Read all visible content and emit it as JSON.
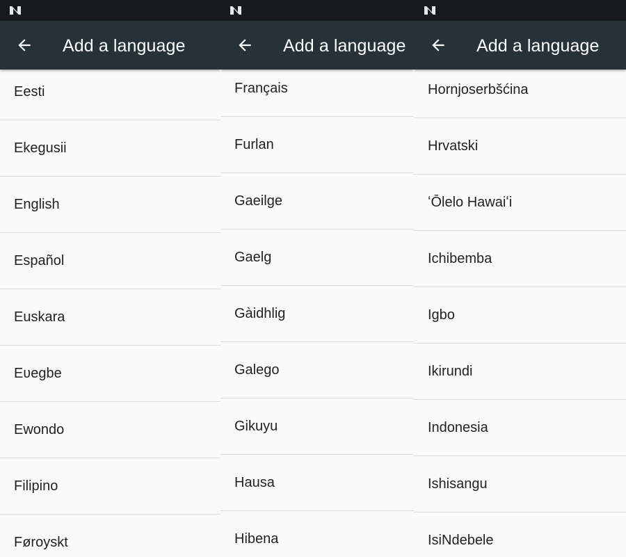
{
  "colors": {
    "status_bar": "#141a1e",
    "app_bar": "#263238",
    "background": "#fafafa",
    "divider": "#dcdcdc",
    "text_primary": "#212121",
    "title_text": "#ffffff"
  },
  "screens": [
    {
      "status_icon": "android-n-logo-icon",
      "back_icon": "arrow-back-icon",
      "title": "Add a language",
      "languages": [
        "Eesti",
        "Ekegusii",
        "English",
        "Español",
        "Euskara",
        "Eʋegbe",
        "Ewondo",
        "Filipino",
        "Føroyskt"
      ]
    },
    {
      "status_icon": "android-n-logo-icon",
      "back_icon": "arrow-back-icon",
      "title": "Add a language",
      "languages": [
        "Français",
        "Furlan",
        "Gaeilge",
        "Gaelg",
        "Gàidhlig",
        "Galego",
        "Gikuyu",
        "Hausa",
        "Hibena"
      ]
    },
    {
      "status_icon": "android-n-logo-icon",
      "back_icon": "arrow-back-icon",
      "title": "Add a language",
      "languages": [
        "Hornjoserbšćina",
        "Hrvatski",
        "ʻŌlelo Hawaiʻi",
        "Ichibemba",
        "Igbo",
        "Ikirundi",
        "Indonesia",
        "Ishisangu",
        "IsiNdebele"
      ]
    }
  ]
}
